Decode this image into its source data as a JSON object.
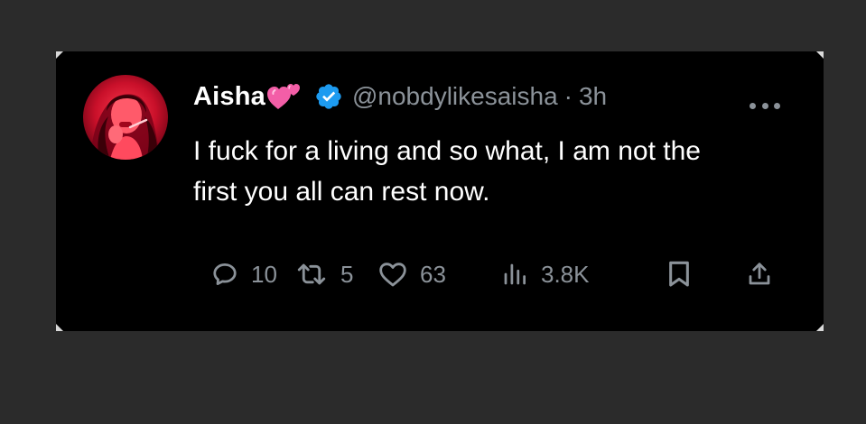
{
  "tweet": {
    "display_name": "Aisha",
    "name_emoji": "pink-two-hearts-emoji",
    "verified": true,
    "handle": "@nobdylikesaisha",
    "separator": "·",
    "timestamp": "3h",
    "text": "I fuck for a living and so what, I am not the first you all can rest now.",
    "avatar_description": "red-tinted profile photo",
    "metrics": {
      "replies": "10",
      "retweets": "5",
      "likes": "63",
      "views": "3.8K"
    }
  },
  "icons": {
    "verified_badge": "verified-check-icon",
    "more": "more-options-icon",
    "reply": "reply-icon",
    "retweet": "retweet-icon",
    "like": "heart-icon",
    "views": "views-chart-icon",
    "bookmark": "bookmark-icon",
    "share": "share-icon"
  },
  "colors": {
    "background": "#2b2b2b",
    "card": "#000000",
    "text_primary": "#ffffff",
    "text_secondary": "#8b9299",
    "verified_blue": "#1d9bf0",
    "avatar_tint": "#d8172f"
  }
}
